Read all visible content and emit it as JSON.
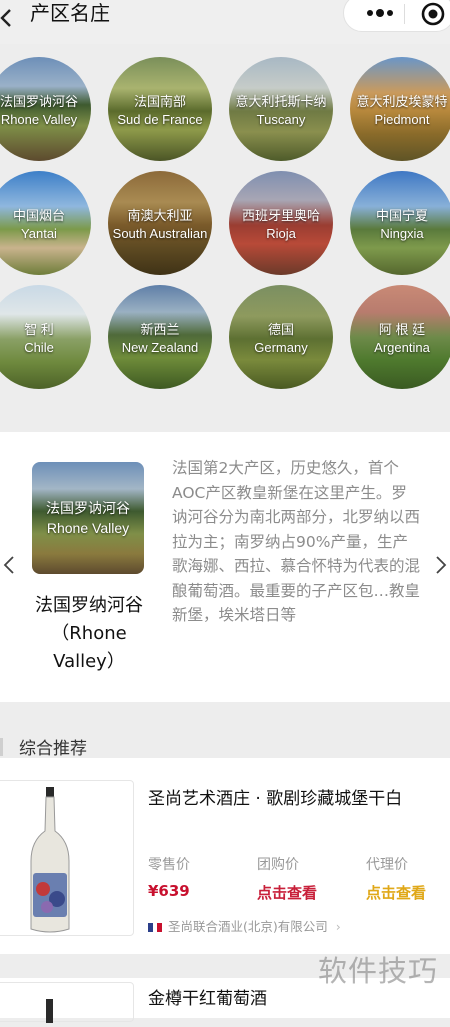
{
  "header": {
    "title": "产区名庄"
  },
  "regions": [
    {
      "cn": "法国罗讷河谷",
      "en": "Rhone Valley"
    },
    {
      "cn": "法国南部",
      "en": "Sud de France"
    },
    {
      "cn": "意大利托斯卡纳",
      "en": "Tuscany"
    },
    {
      "cn": "意大利皮埃蒙特",
      "en": "Piedmont"
    },
    {
      "cn": "中国烟台",
      "en": "Yantai"
    },
    {
      "cn": "南澳大利亚",
      "en": "South Australian"
    },
    {
      "cn": "西班牙里奥哈",
      "en": "Rioja"
    },
    {
      "cn": "中国宁夏",
      "en": "Ningxia"
    },
    {
      "cn": "智 利",
      "en": "Chile"
    },
    {
      "cn": "新西兰",
      "en": "New Zealand"
    },
    {
      "cn": "德国",
      "en": "Germany"
    },
    {
      "cn": "阿 根 廷",
      "en": "Argentina"
    }
  ],
  "featured": {
    "image_cn": "法国罗讷河谷",
    "image_en": "Rhone Valley",
    "name": "法国罗纳河谷（Rhone Valley）",
    "description": "法国第2大产区，历史悠久，首个AOC产区教皇新堡在这里产生。罗讷河谷分为南北两部分，北罗纳以西拉为主；南罗纳占90%产量，生产歌海娜、西拉、慕合怀特为代表的混酿葡萄酒。最重要的子产区包…教皇新堡，埃米塔日等"
  },
  "recommend": {
    "title": "综合推荐",
    "products": [
      {
        "name": "圣尚艺术酒庄 · 歌剧珍藏城堡干白",
        "retail_label": "零售价",
        "retail_price": "¥639",
        "group_label": "团购价",
        "group_value": "点击查看",
        "agent_label": "代理价",
        "agent_value": "点击查看",
        "seller": "圣尚联合酒业(北京)有限公司"
      },
      {
        "name": "金樽干红葡萄酒"
      }
    ]
  },
  "watermark": "软件技巧",
  "colors": {
    "price_red": "#c8102e",
    "group_red": "#c8203a",
    "agent_gold": "#e0a818"
  }
}
